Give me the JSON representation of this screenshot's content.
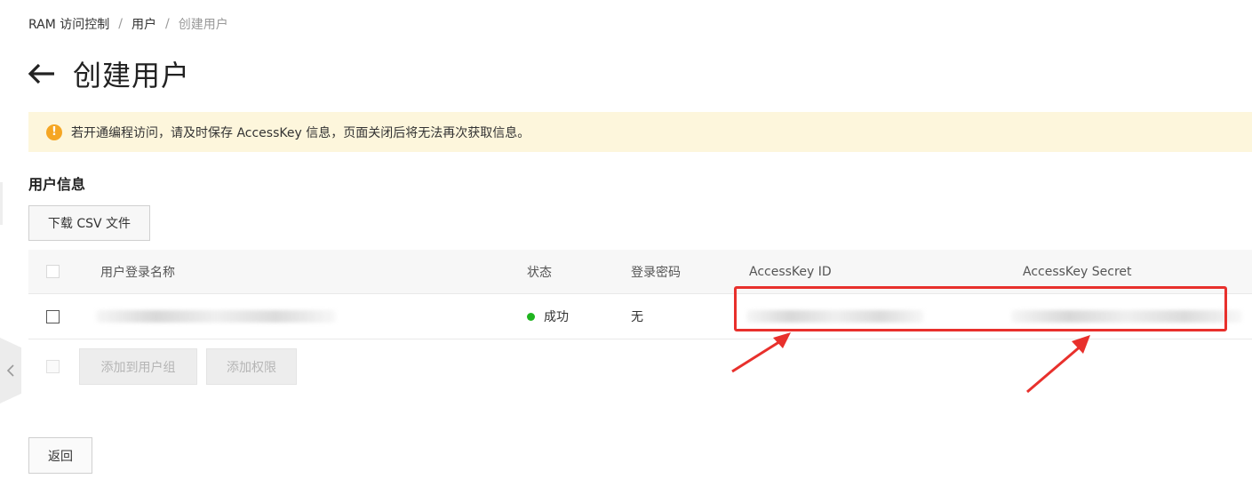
{
  "breadcrumb": {
    "items": [
      "RAM 访问控制",
      "用户",
      "创建用户"
    ],
    "separator": "/"
  },
  "page": {
    "title": "创建用户"
  },
  "alert": {
    "icon": "exclamation-icon",
    "text": "若开通编程访问，请及时保存 AccessKey 信息，页面关闭后将无法再次获取信息。"
  },
  "section": {
    "title": "用户信息"
  },
  "toolbar": {
    "download_label": "下载 CSV 文件"
  },
  "table": {
    "columns": [
      "用户登录名称",
      "状态",
      "登录密码",
      "AccessKey ID",
      "AccessKey Secret"
    ],
    "rows": [
      {
        "status": "成功",
        "password": "无"
      }
    ]
  },
  "actions": {
    "add_to_group_label": "添加到用户组",
    "add_permission_label": "添加权限"
  },
  "footer": {
    "back_label": "返回"
  },
  "colors": {
    "alert_bg": "#fdf6dc",
    "alert_icon": "#f5a623",
    "status_success": "#1fb41f",
    "annotation_red": "#e8302c"
  }
}
